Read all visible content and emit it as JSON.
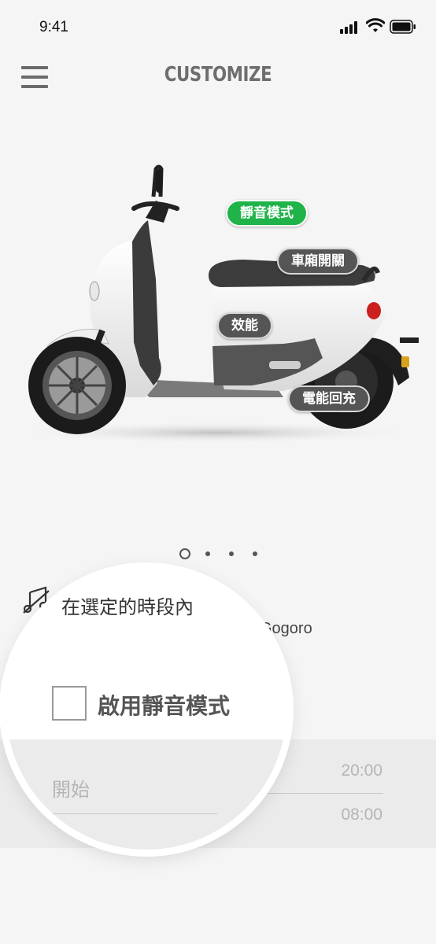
{
  "status_bar": {
    "time": "9:41"
  },
  "header": {
    "title": "CUSTOMIZE"
  },
  "features": [
    {
      "label": "靜音模式",
      "active": true
    },
    {
      "label": "車廂開關",
      "active": false
    },
    {
      "label": "效能",
      "active": false
    },
    {
      "label": "電能回充",
      "active": false
    }
  ],
  "pager": {
    "count": 4,
    "active_index": 0
  },
  "description": {
    "line1": "在選定的時段內",
    "line2": "Gogoro"
  },
  "mute_toggle": {
    "label": "啟用靜音模式",
    "checked": false
  },
  "schedule": {
    "start_label": "開始",
    "start_time": "20:00",
    "end_time": "08:00"
  },
  "colors": {
    "accent_green": "#1fb34a",
    "pill_dark": "#555555"
  }
}
